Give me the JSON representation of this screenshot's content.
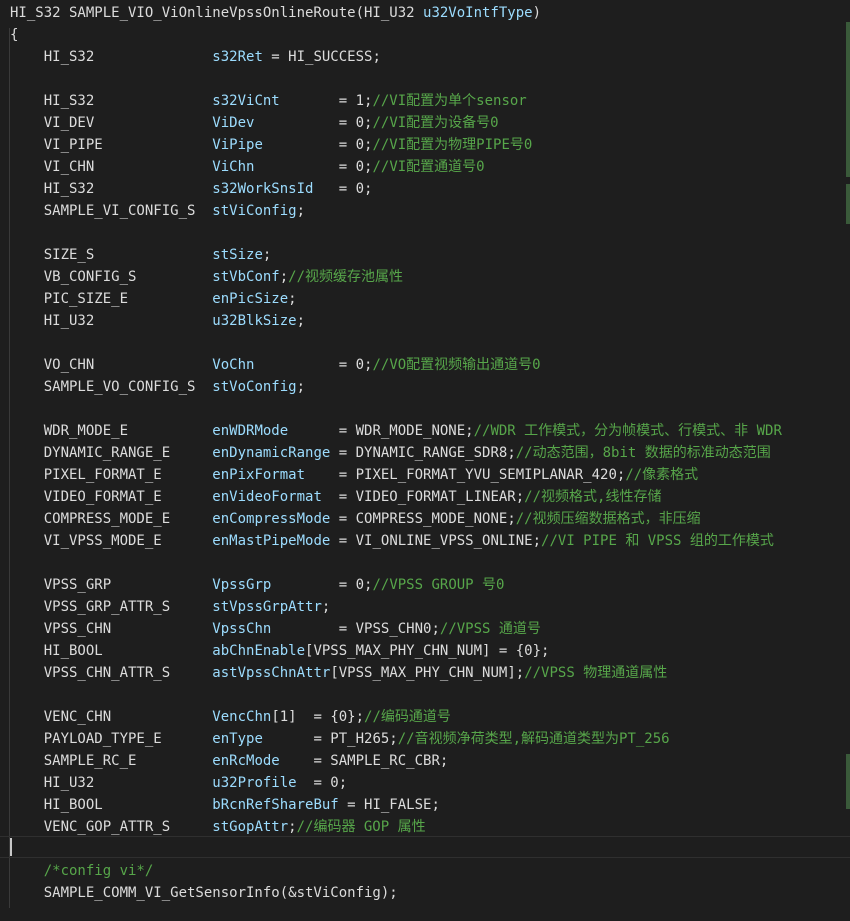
{
  "lines": [
    {
      "parts": [
        {
          "t": "HI_S32 SAMPLE_VIO_ViOnlineVpssOnlineRoute(HI_U32 ",
          "c": "pl"
        },
        {
          "t": "u32VoIntfType",
          "c": "vr"
        },
        {
          "t": ")",
          "c": "pl"
        }
      ]
    },
    {
      "parts": [
        {
          "t": "{",
          "c": "pl"
        }
      ]
    },
    {
      "parts": [
        {
          "t": "    HI_S32              ",
          "c": "ty"
        },
        {
          "t": "s32Ret",
          "c": "vr"
        },
        {
          "t": " = HI_SUCCESS;",
          "c": "pl"
        }
      ]
    },
    {
      "parts": []
    },
    {
      "parts": [
        {
          "t": "    HI_S32              ",
          "c": "ty"
        },
        {
          "t": "s32ViCnt",
          "c": "vr"
        },
        {
          "t": "       = 1;",
          "c": "pl"
        },
        {
          "t": "//VI配置为单个sensor",
          "c": "cm"
        }
      ]
    },
    {
      "parts": [
        {
          "t": "    VI_DEV              ",
          "c": "ty"
        },
        {
          "t": "ViDev",
          "c": "vr"
        },
        {
          "t": "          = 0;",
          "c": "pl"
        },
        {
          "t": "//VI配置为设备号0",
          "c": "cm"
        }
      ]
    },
    {
      "parts": [
        {
          "t": "    VI_PIPE             ",
          "c": "ty"
        },
        {
          "t": "ViPipe",
          "c": "vr"
        },
        {
          "t": "         = 0;",
          "c": "pl"
        },
        {
          "t": "//VI配置为物理PIPE号0",
          "c": "cm"
        }
      ]
    },
    {
      "parts": [
        {
          "t": "    VI_CHN              ",
          "c": "ty"
        },
        {
          "t": "ViChn",
          "c": "vr"
        },
        {
          "t": "          = 0;",
          "c": "pl"
        },
        {
          "t": "//VI配置通道号0",
          "c": "cm"
        }
      ]
    },
    {
      "parts": [
        {
          "t": "    HI_S32              ",
          "c": "ty"
        },
        {
          "t": "s32WorkSnsId",
          "c": "vr"
        },
        {
          "t": "   = 0;",
          "c": "pl"
        }
      ]
    },
    {
      "parts": [
        {
          "t": "    SAMPLE_VI_CONFIG_S  ",
          "c": "ty"
        },
        {
          "t": "stViConfig",
          "c": "vr"
        },
        {
          "t": ";",
          "c": "pl"
        }
      ]
    },
    {
      "parts": []
    },
    {
      "parts": [
        {
          "t": "    SIZE_S              ",
          "c": "ty"
        },
        {
          "t": "stSize",
          "c": "vr"
        },
        {
          "t": ";",
          "c": "pl"
        }
      ]
    },
    {
      "parts": [
        {
          "t": "    VB_CONFIG_S         ",
          "c": "ty"
        },
        {
          "t": "stVbConf",
          "c": "vr"
        },
        {
          "t": ";",
          "c": "pl"
        },
        {
          "t": "//视频缓存池属性",
          "c": "cm"
        }
      ]
    },
    {
      "parts": [
        {
          "t": "    PIC_SIZE_E          ",
          "c": "ty"
        },
        {
          "t": "enPicSize",
          "c": "vr"
        },
        {
          "t": ";",
          "c": "pl"
        }
      ]
    },
    {
      "parts": [
        {
          "t": "    HI_U32              ",
          "c": "ty"
        },
        {
          "t": "u32BlkSize",
          "c": "vr"
        },
        {
          "t": ";",
          "c": "pl"
        }
      ]
    },
    {
      "parts": []
    },
    {
      "parts": [
        {
          "t": "    VO_CHN              ",
          "c": "ty"
        },
        {
          "t": "VoChn",
          "c": "vr"
        },
        {
          "t": "          = 0;",
          "c": "pl"
        },
        {
          "t": "//VO配置视频输出通道号0",
          "c": "cm"
        }
      ]
    },
    {
      "parts": [
        {
          "t": "    SAMPLE_VO_CONFIG_S  ",
          "c": "ty"
        },
        {
          "t": "stVoConfig",
          "c": "vr"
        },
        {
          "t": ";",
          "c": "pl"
        }
      ]
    },
    {
      "parts": []
    },
    {
      "parts": [
        {
          "t": "    WDR_MODE_E          ",
          "c": "ty"
        },
        {
          "t": "enWDRMode",
          "c": "vr"
        },
        {
          "t": "      = WDR_MODE_NONE;",
          "c": "pl"
        },
        {
          "t": "//WDR 工作模式，分为帧模式、行模式、非 WDR",
          "c": "cm"
        }
      ]
    },
    {
      "parts": [
        {
          "t": "    DYNAMIC_RANGE_E     ",
          "c": "ty"
        },
        {
          "t": "enDynamicRange",
          "c": "vr"
        },
        {
          "t": " = DYNAMIC_RANGE_SDR8;",
          "c": "pl"
        },
        {
          "t": "//动态范围，8bit 数据的标准动态范围",
          "c": "cm"
        }
      ]
    },
    {
      "parts": [
        {
          "t": "    PIXEL_FORMAT_E      ",
          "c": "ty"
        },
        {
          "t": "enPixFormat",
          "c": "vr"
        },
        {
          "t": "    = PIXEL_FORMAT_YVU_SEMIPLANAR_420;",
          "c": "pl"
        },
        {
          "t": "//像素格式",
          "c": "cm"
        }
      ]
    },
    {
      "parts": [
        {
          "t": "    VIDEO_FORMAT_E      ",
          "c": "ty"
        },
        {
          "t": "enVideoFormat",
          "c": "vr"
        },
        {
          "t": "  = VIDEO_FORMAT_LINEAR;",
          "c": "pl"
        },
        {
          "t": "//视频格式,线性存储",
          "c": "cm"
        }
      ]
    },
    {
      "parts": [
        {
          "t": "    COMPRESS_MODE_E     ",
          "c": "ty"
        },
        {
          "t": "enCompressMode",
          "c": "vr"
        },
        {
          "t": " = COMPRESS_MODE_NONE;",
          "c": "pl"
        },
        {
          "t": "//视频压缩数据格式，非压缩",
          "c": "cm"
        }
      ]
    },
    {
      "parts": [
        {
          "t": "    VI_VPSS_MODE_E      ",
          "c": "ty"
        },
        {
          "t": "enMastPipeMode",
          "c": "vr"
        },
        {
          "t": " = VI_ONLINE_VPSS_ONLINE;",
          "c": "pl"
        },
        {
          "t": "//VI PIPE 和 VPSS 组的工作模式",
          "c": "cm"
        }
      ]
    },
    {
      "parts": []
    },
    {
      "parts": [
        {
          "t": "    VPSS_GRP            ",
          "c": "ty"
        },
        {
          "t": "VpssGrp",
          "c": "vr"
        },
        {
          "t": "        = 0;",
          "c": "pl"
        },
        {
          "t": "//VPSS GROUP 号0",
          "c": "cm"
        }
      ]
    },
    {
      "parts": [
        {
          "t": "    VPSS_GRP_ATTR_S     ",
          "c": "ty"
        },
        {
          "t": "stVpssGrpAttr",
          "c": "vr"
        },
        {
          "t": ";",
          "c": "pl"
        }
      ]
    },
    {
      "parts": [
        {
          "t": "    VPSS_CHN            ",
          "c": "ty"
        },
        {
          "t": "VpssChn",
          "c": "vr"
        },
        {
          "t": "        = VPSS_CHN0;",
          "c": "pl"
        },
        {
          "t": "//VPSS 通道号",
          "c": "cm"
        }
      ]
    },
    {
      "parts": [
        {
          "t": "    HI_BOOL             ",
          "c": "ty"
        },
        {
          "t": "abChnEnable",
          "c": "vr"
        },
        {
          "t": "[VPSS_MAX_PHY_CHN_NUM] = {0};",
          "c": "pl"
        }
      ]
    },
    {
      "parts": [
        {
          "t": "    VPSS_CHN_ATTR_S     ",
          "c": "ty"
        },
        {
          "t": "astVpssChnAttr",
          "c": "vr"
        },
        {
          "t": "[VPSS_MAX_PHY_CHN_NUM];",
          "c": "pl"
        },
        {
          "t": "//VPSS 物理通道属性",
          "c": "cm"
        }
      ]
    },
    {
      "parts": []
    },
    {
      "parts": [
        {
          "t": "    VENC_CHN            ",
          "c": "ty"
        },
        {
          "t": "VencChn",
          "c": "vr"
        },
        {
          "t": "[1]  = {0};",
          "c": "pl"
        },
        {
          "t": "//编码通道号",
          "c": "cm"
        }
      ]
    },
    {
      "parts": [
        {
          "t": "    PAYLOAD_TYPE_E      ",
          "c": "ty"
        },
        {
          "t": "enType",
          "c": "vr"
        },
        {
          "t": "      = PT_H265;",
          "c": "pl"
        },
        {
          "t": "//音视频净荷类型,解码通道类型为PT_256",
          "c": "cm"
        }
      ]
    },
    {
      "parts": [
        {
          "t": "    SAMPLE_RC_E         ",
          "c": "ty"
        },
        {
          "t": "enRcMode",
          "c": "vr"
        },
        {
          "t": "    = SAMPLE_RC_CBR;",
          "c": "pl"
        }
      ]
    },
    {
      "parts": [
        {
          "t": "    HI_U32              ",
          "c": "ty"
        },
        {
          "t": "u32Profile",
          "c": "vr"
        },
        {
          "t": "  = 0;",
          "c": "pl"
        }
      ]
    },
    {
      "parts": [
        {
          "t": "    HI_BOOL             ",
          "c": "ty"
        },
        {
          "t": "bRcnRefShareBuf",
          "c": "vr"
        },
        {
          "t": " = HI_FALSE;",
          "c": "pl"
        }
      ]
    },
    {
      "parts": [
        {
          "t": "    VENC_GOP_ATTR_S     ",
          "c": "ty"
        },
        {
          "t": "stGopAttr",
          "c": "vr"
        },
        {
          "t": ";",
          "c": "pl"
        },
        {
          "t": "//编码器 GOP 属性",
          "c": "cm"
        }
      ]
    },
    {
      "parts": []
    },
    {
      "parts": [
        {
          "t": "    /*config vi*/",
          "c": "cm"
        }
      ]
    },
    {
      "parts": [
        {
          "t": "    SAMPLE_COMM_VI_GetSensorInfo(&stViConfig);",
          "c": "pl"
        }
      ]
    }
  ],
  "theme": {
    "background": "#1e1e1e",
    "plain": "#dcdcdc",
    "variable": "#9cdcfe",
    "comment": "#57a64a"
  }
}
